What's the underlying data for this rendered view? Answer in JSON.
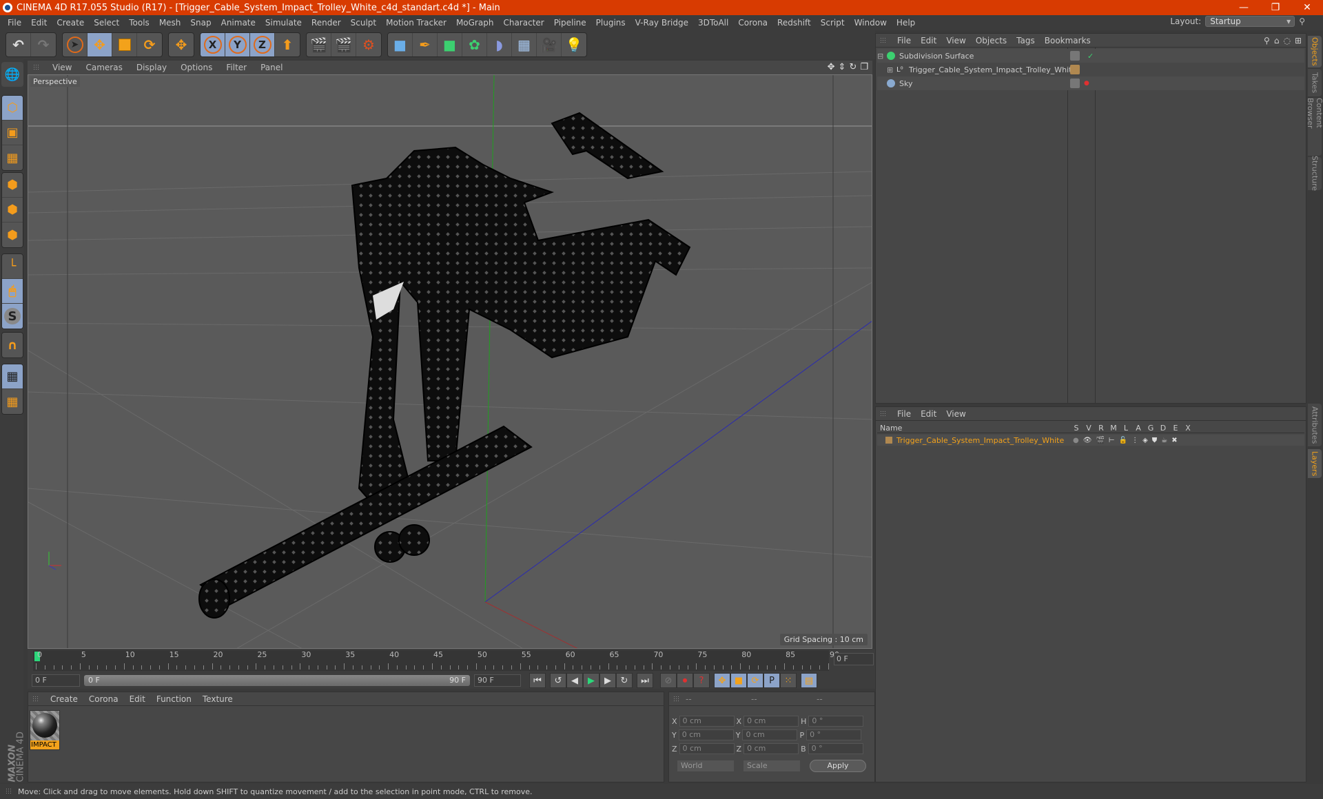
{
  "window": {
    "title": "CINEMA 4D R17.055 Studio (R17) - [Trigger_Cable_System_Impact_Trolley_White_c4d_standart.c4d *] - Main",
    "controls": {
      "minimize": "—",
      "restore": "❐",
      "close": "✕"
    }
  },
  "menubar": [
    "File",
    "Edit",
    "Create",
    "Select",
    "Tools",
    "Mesh",
    "Snap",
    "Animate",
    "Simulate",
    "Render",
    "Sculpt",
    "Motion Tracker",
    "MoGraph",
    "Character",
    "Pipeline",
    "Plugins",
    "V-Ray Bridge",
    "3DToAll",
    "Corona",
    "Redshift",
    "Script",
    "Window",
    "Help"
  ],
  "layout": {
    "label": "Layout:",
    "value": "Startup"
  },
  "toolbar": {
    "undo": "↶",
    "redo": "↷",
    "axis_x": "X",
    "axis_y": "Y",
    "axis_z": "Z"
  },
  "viewport": {
    "menu": [
      "View",
      "Cameras",
      "Display",
      "Options",
      "Filter",
      "Panel"
    ],
    "camera_label": "Perspective",
    "grid_spacing": "Grid Spacing : 10 cm"
  },
  "timeline": {
    "ticks": [
      "0",
      "5",
      "10",
      "15",
      "20",
      "25",
      "30",
      "35",
      "40",
      "45",
      "50",
      "55",
      "60",
      "65",
      "70",
      "75",
      "80",
      "85",
      "90"
    ],
    "current_frame": "0 F",
    "start_field": "0 F",
    "range_start": "0 F",
    "range_end": "90 F",
    "end_field": "90 F"
  },
  "material_manager": {
    "menu": [
      "Create",
      "Corona",
      "Edit",
      "Function",
      "Texture"
    ],
    "materials": [
      {
        "name": "IMPACT"
      }
    ]
  },
  "brand": {
    "maxon": "MAXON",
    "product": "CINEMA 4D"
  },
  "coordinates": {
    "headers": [
      "--",
      "--",
      "--"
    ],
    "rows": [
      {
        "a": "X",
        "av": "0 cm",
        "b": "X",
        "bv": "0 cm",
        "c": "H",
        "cv": "0 °"
      },
      {
        "a": "Y",
        "av": "0 cm",
        "b": "Y",
        "bv": "0 cm",
        "c": "P",
        "cv": "0 °"
      },
      {
        "a": "Z",
        "av": "0 cm",
        "b": "Z",
        "bv": "0 cm",
        "c": "B",
        "cv": "0 °"
      }
    ],
    "mode": "World",
    "transform": "Scale",
    "apply": "Apply"
  },
  "object_manager": {
    "menu": [
      "File",
      "Edit",
      "View",
      "Objects",
      "Tags",
      "Bookmarks"
    ],
    "objects": [
      {
        "name": "Subdivision Surface",
        "checked": "✓"
      },
      {
        "name": "Trigger_Cable_System_Impact_Trolley_White"
      },
      {
        "name": "Sky"
      }
    ]
  },
  "layer_manager": {
    "menu": [
      "File",
      "Edit",
      "View"
    ],
    "columns": [
      "Name",
      "S",
      "V",
      "R",
      "M",
      "L",
      "A",
      "G",
      "D",
      "E",
      "X"
    ],
    "layers": [
      {
        "name": "Trigger_Cable_System_Impact_Trolley_White",
        "color": "#b08850"
      }
    ]
  },
  "right_tabs": {
    "top": [
      "Objects",
      "Takes",
      "Content Browser",
      "Structure"
    ],
    "bottom": [
      "Attributes",
      "Layers"
    ]
  },
  "status": "Move: Click and drag to move elements. Hold down SHIFT to quantize movement / add to the selection in point mode, CTRL to remove.",
  "colors": {
    "accent": "#f3a21b",
    "titlebar": "#d83b01",
    "selected_tool": "#8ca3c8"
  }
}
